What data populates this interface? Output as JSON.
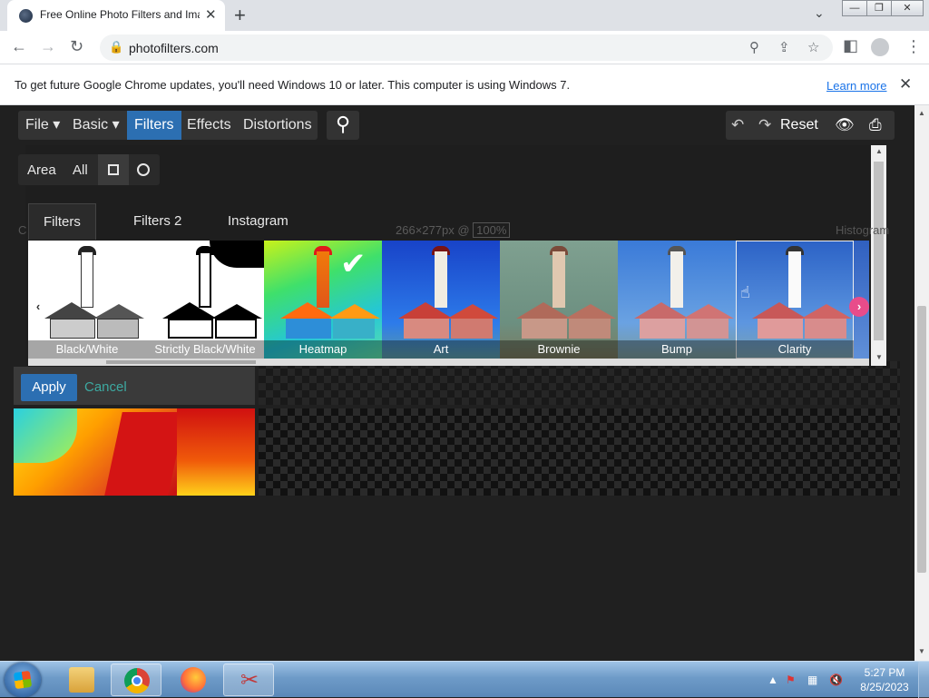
{
  "browser": {
    "tab_title": "Free Online Photo Filters and Image Effects",
    "new_tab": "+",
    "tab_close": "✕",
    "url": "photofilters.com",
    "window_controls": {
      "minimize": "—",
      "restore": "❐",
      "close": "✕"
    }
  },
  "infobar": {
    "message": "To get future Google Chrome updates, you'll need Windows 10 or later. This computer is using Windows 7.",
    "link": "Learn more",
    "close": "✕"
  },
  "app": {
    "menu": [
      "File ▾",
      "Basic ▾",
      "Filters",
      "Effects",
      "Distortions"
    ],
    "active_menu": "Filters",
    "search_icon": "⚲",
    "undo": "↶",
    "redo": "↷",
    "reset": "Reset",
    "eye_icon": "👁",
    "print_icon": "⎙",
    "area": {
      "label": "Area",
      "all": "All"
    },
    "tabs": [
      "Filters",
      "Filters 2",
      "Instagram"
    ],
    "active_tab": "Filters",
    "size_info": "266×277px @",
    "zoom": "100%",
    "histogram_label": "Histogram",
    "cut_letter": "C",
    "filters": [
      {
        "name": "Black/White",
        "selected": false,
        "checked": false
      },
      {
        "name": "Strictly Black/White",
        "selected": false,
        "checked": false
      },
      {
        "name": "Heatmap",
        "selected": false,
        "checked": true
      },
      {
        "name": "Art",
        "selected": false,
        "checked": false
      },
      {
        "name": "Brownie",
        "selected": false,
        "checked": false
      },
      {
        "name": "Bump",
        "selected": false,
        "checked": false
      },
      {
        "name": "Clarity",
        "selected": true,
        "checked": false
      }
    ],
    "prev_arrow": "‹",
    "next_arrow": "›",
    "apply": "Apply",
    "cancel": "Cancel"
  },
  "taskbar": {
    "apps": [
      "windows-explorer",
      "chrome",
      "firefox",
      "snipping-tool"
    ],
    "time": "5:27 PM",
    "date": "8/25/2023"
  },
  "colors": {
    "accent": "#2c6fb2",
    "cancel": "#3da9a1",
    "next_arrow": "#e84c8a"
  }
}
